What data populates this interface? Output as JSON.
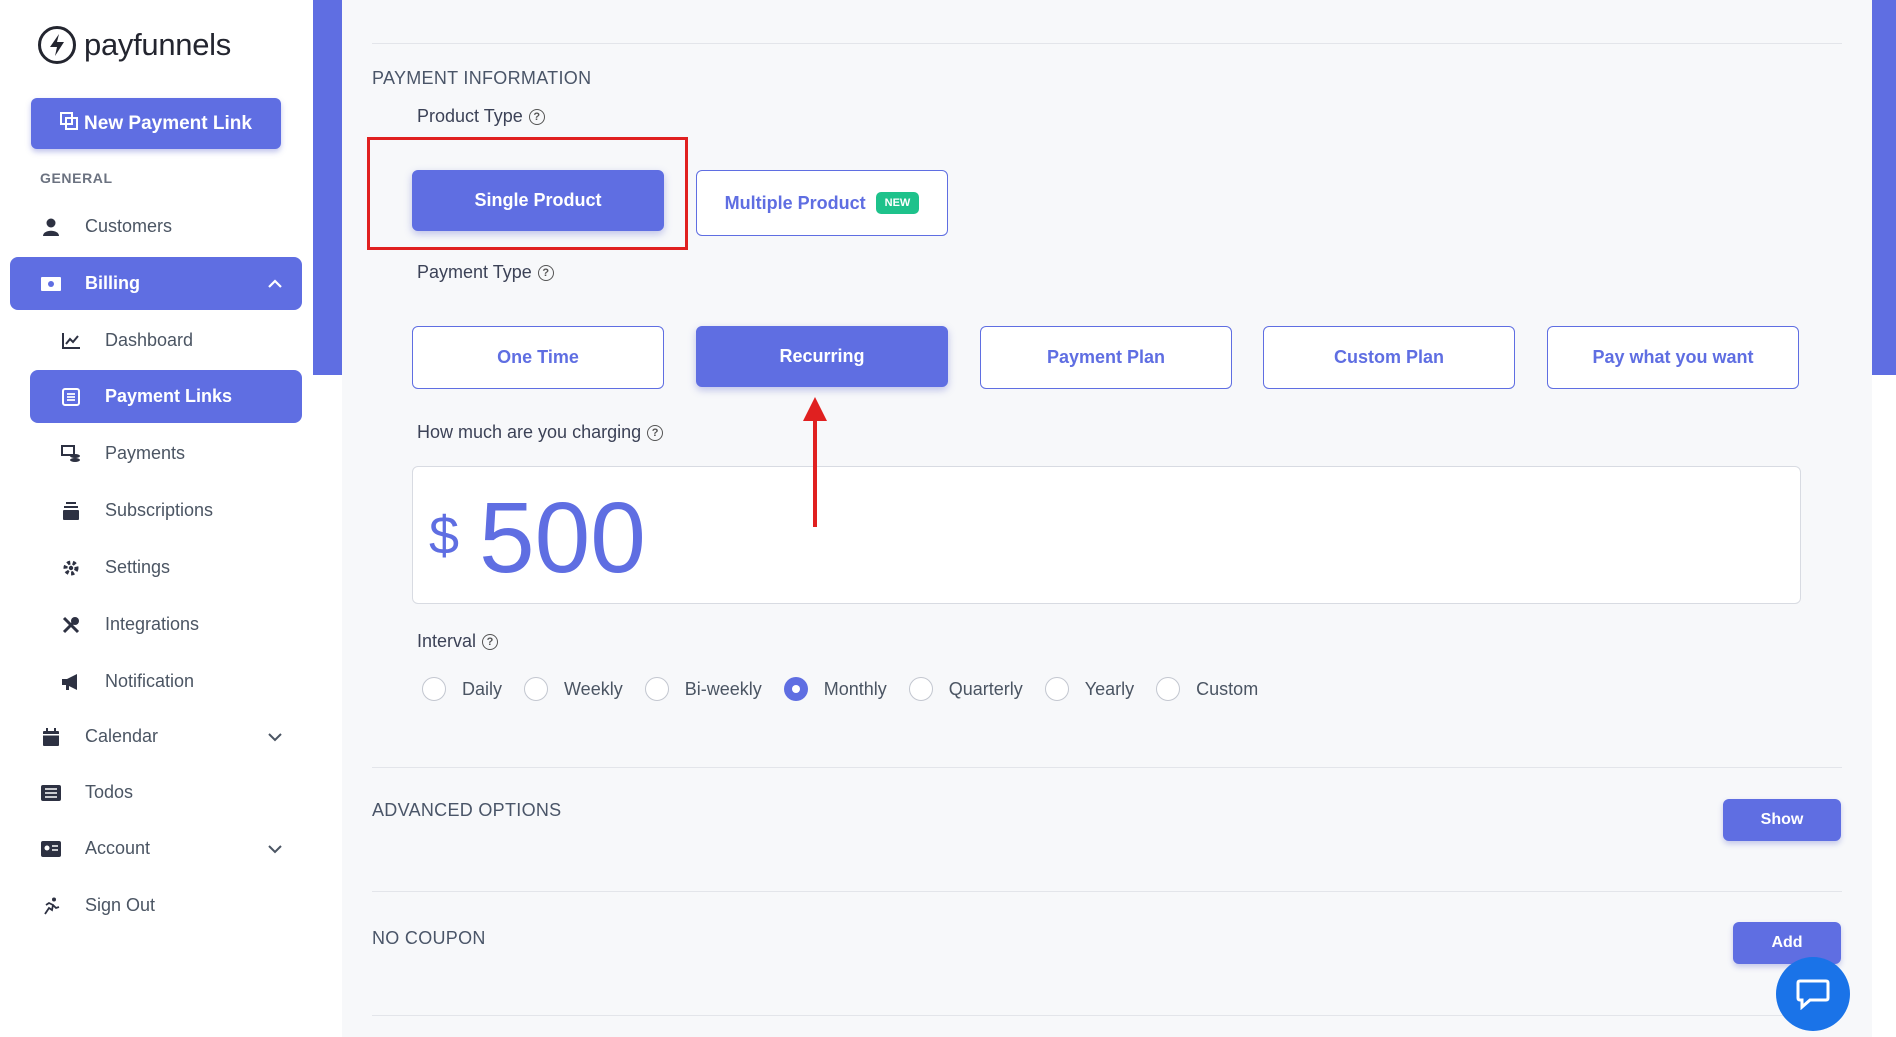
{
  "brand": {
    "name": "payfunnels",
    "accent": "#5f6ee2",
    "badge_green": "#1ec28b"
  },
  "sidebar": {
    "new_link_label": "New Payment Link",
    "section_label": "GENERAL",
    "items": [
      {
        "label": "Customers",
        "icon": "user-icon"
      },
      {
        "label": "Billing",
        "icon": "money-icon",
        "active": true,
        "expanded": true
      },
      {
        "label": "Calendar",
        "icon": "calendar-icon"
      },
      {
        "label": "Todos",
        "icon": "list-icon"
      },
      {
        "label": "Account",
        "icon": "id-card-icon"
      },
      {
        "label": "Sign Out",
        "icon": "running-icon"
      }
    ],
    "billing_sub": [
      {
        "label": "Dashboard",
        "icon": "chart-line-icon"
      },
      {
        "label": "Payment Links",
        "icon": "link-list-icon",
        "active": true
      },
      {
        "label": "Payments",
        "icon": "payments-icon"
      },
      {
        "label": "Subscriptions",
        "icon": "subscriptions-icon"
      },
      {
        "label": "Settings",
        "icon": "gear-icon"
      },
      {
        "label": "Integrations",
        "icon": "tools-icon"
      },
      {
        "label": "Notification",
        "icon": "megaphone-icon"
      }
    ]
  },
  "main": {
    "payment_info_title": "PAYMENT INFORMATION",
    "product_type_label": "Product Type",
    "product_types": [
      {
        "label": "Single Product",
        "selected": true
      },
      {
        "label": "Multiple Product",
        "badge": "NEW",
        "selected": false
      }
    ],
    "payment_type_label": "Payment Type",
    "payment_types": [
      {
        "label": "One Time",
        "selected": false
      },
      {
        "label": "Recurring",
        "selected": true
      },
      {
        "label": "Payment Plan",
        "selected": false
      },
      {
        "label": "Custom Plan",
        "selected": false
      },
      {
        "label": "Pay what you want",
        "selected": false
      }
    ],
    "charging_label": "How much are you charging",
    "currency_symbol": "$",
    "amount": "500",
    "interval_label": "Interval",
    "intervals": [
      {
        "label": "Daily",
        "checked": false
      },
      {
        "label": "Weekly",
        "checked": false
      },
      {
        "label": "Bi-weekly",
        "checked": false
      },
      {
        "label": "Monthly",
        "checked": true
      },
      {
        "label": "Quarterly",
        "checked": false
      },
      {
        "label": "Yearly",
        "checked": false
      },
      {
        "label": "Custom",
        "checked": false
      }
    ],
    "advanced_title": "ADVANCED OPTIONS",
    "advanced_button": "Show",
    "coupon_title": "NO COUPON",
    "coupon_button": "Add",
    "help_glyph": "?"
  }
}
